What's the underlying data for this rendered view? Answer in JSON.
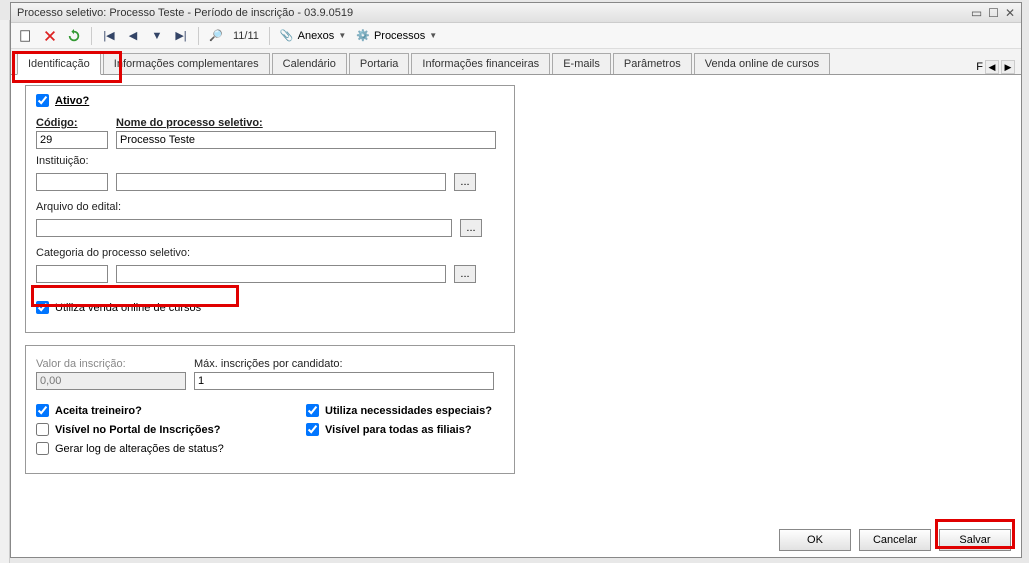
{
  "title": "Processo seletivo: Processo Teste - Período de inscrição - 03.9.0519",
  "toolbar": {
    "record": "11/11",
    "anexos": "Anexos",
    "processos": "Processos"
  },
  "tabs": [
    "Identificação",
    "Informações complementares",
    "Calendário",
    "Portaria",
    "Informações financeiras",
    "E-mails",
    "Parâmetros",
    "Venda online de cursos"
  ],
  "tabextra": "F",
  "panel1": {
    "ativo_label": "Ativo?",
    "ativo_checked": true,
    "codigo_label": "Código:",
    "codigo_value": "29",
    "nome_label": "Nome do processo seletivo:",
    "nome_value": "Processo Teste",
    "instituicao_label": "Instituição:",
    "instituicao_code": "",
    "instituicao_name": "",
    "arquivo_label": "Arquivo do edital:",
    "arquivo_value": "",
    "categoria_label": "Categoria do processo seletivo:",
    "categoria_code": "",
    "categoria_name": "",
    "utiliza_label": "Utiliza venda online de cursos",
    "utiliza_checked": true
  },
  "panel2": {
    "valor_label": "Valor da inscrição:",
    "valor_value": "0,00",
    "max_label": "Máx. inscrições por candidato:",
    "max_value": "1",
    "aceita_treineiro": "Aceita treineiro?",
    "aceita_treineiro_checked": true,
    "utiliza_necessidades": "Utiliza necessidades especiais?",
    "utiliza_necessidades_checked": true,
    "visivel_portal": "Visível no Portal de Inscrições?",
    "visivel_portal_checked": false,
    "visivel_filiais": "Visível para todas as filiais?",
    "visivel_filiais_checked": true,
    "gerar_log": "Gerar log de alterações de status?",
    "gerar_log_checked": false
  },
  "footer": {
    "ok": "OK",
    "cancelar": "Cancelar",
    "salvar": "Salvar"
  }
}
